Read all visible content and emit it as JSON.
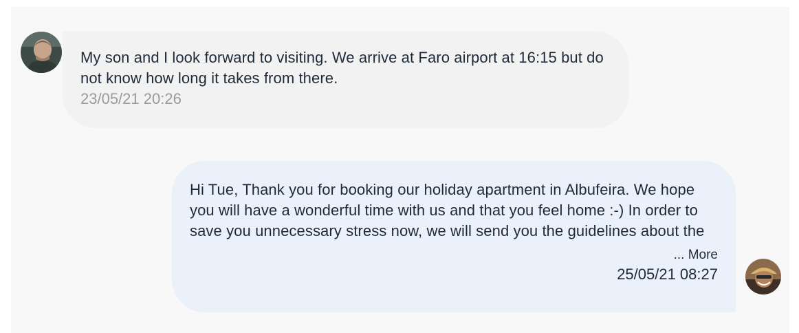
{
  "messages": [
    {
      "text": "My son and I look forward to visiting. We arrive at Faro airport at 16:15 but do not know how long it takes from there.",
      "timestamp": "23/05/21 20:26"
    },
    {
      "text": "Hi Tue, Thank you for booking our holiday apartment in Albufeira. We hope you will have a wonderful time with us and that you feel home :-) In order to save you unnecessary stress now, we will send you the guidelines about the apartment, as well as, key collection",
      "more_label": "... More",
      "timestamp": "25/05/21 08:27"
    }
  ],
  "colors": {
    "panel_bg": "#f8f8f8",
    "guest_bubble": "#f2f2f2",
    "host_bubble": "#eaf1fb",
    "text": "#1f2a38",
    "muted": "#9a9a9a"
  }
}
